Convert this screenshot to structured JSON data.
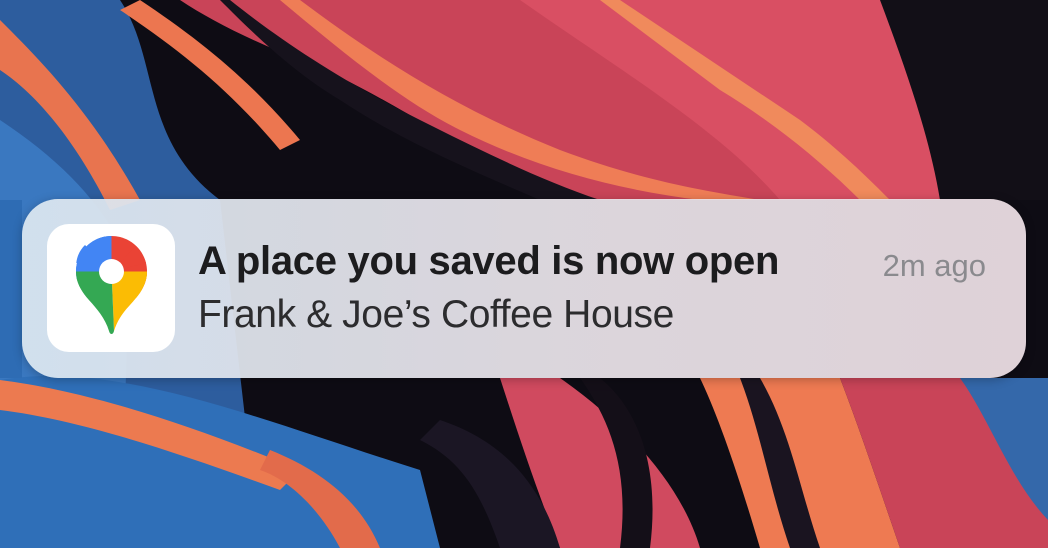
{
  "notification": {
    "app_icon": "google-maps-pin-icon",
    "title": "A place you saved is now open",
    "subtitle": "Frank & Joe’s Coffee House",
    "timestamp": "2m ago"
  },
  "colors": {
    "maps_blue": "#4285F4",
    "maps_red": "#EA4335",
    "maps_yellow": "#FBBC04",
    "maps_green": "#34A853",
    "wallpaper_red": "#d94a5e",
    "wallpaper_orange": "#ee7a52",
    "wallpaper_blue": "#3d7ec4"
  }
}
